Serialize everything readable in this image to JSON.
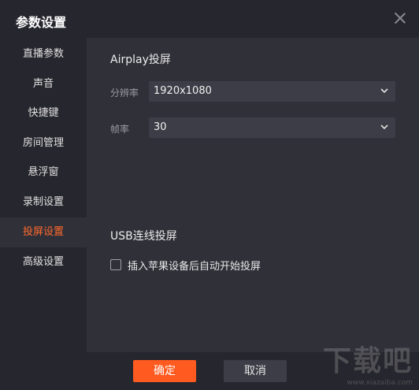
{
  "window": {
    "title": "参数设置"
  },
  "sidebar": {
    "items": [
      {
        "label": "直播参数",
        "active": false
      },
      {
        "label": "声音",
        "active": false
      },
      {
        "label": "快捷键",
        "active": false
      },
      {
        "label": "房间管理",
        "active": false
      },
      {
        "label": "悬浮窗",
        "active": false
      },
      {
        "label": "录制设置",
        "active": false
      },
      {
        "label": "投屏设置",
        "active": true
      },
      {
        "label": "高级设置",
        "active": false
      }
    ]
  },
  "airplay": {
    "title": "Airplay投屏",
    "resolution_label": "分辨率",
    "resolution_value": "1920x1080",
    "framerate_label": "帧率",
    "framerate_value": "30"
  },
  "usb": {
    "title": "USB连线投屏",
    "auto_start_label": "插入苹果设备后自动开始投屏",
    "auto_start_checked": false
  },
  "footer": {
    "ok_label": "确定",
    "cancel_label": "取消"
  },
  "watermark": {
    "text": "下载吧",
    "url": "www.xiazaiba.com"
  },
  "colors": {
    "accent": "#ff5a1f",
    "active_text": "#ff6a2b",
    "panel": "#303039",
    "chrome": "#26262e"
  }
}
